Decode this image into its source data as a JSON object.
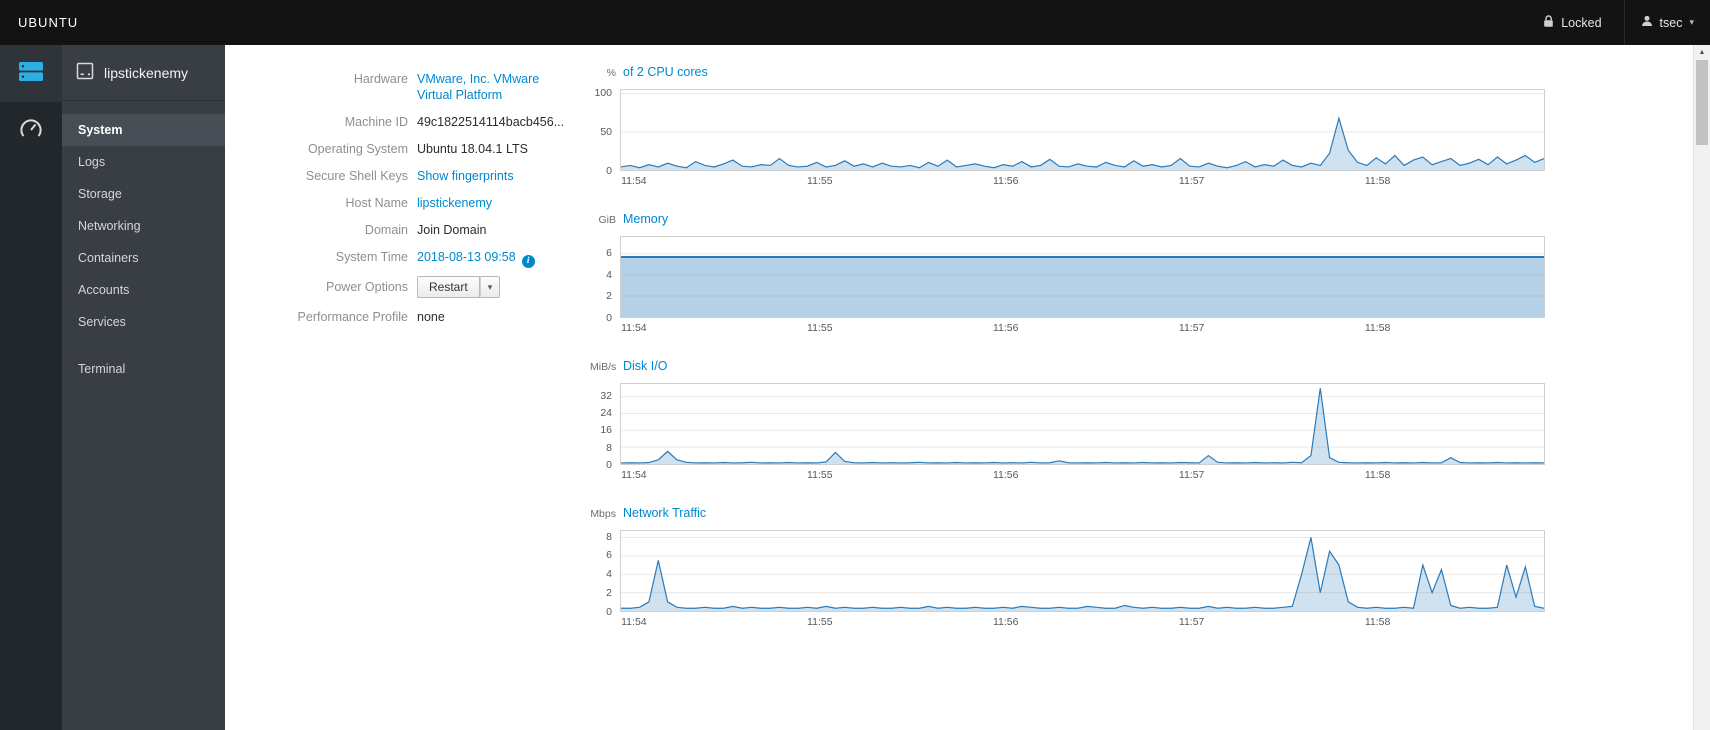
{
  "topbar": {
    "brand": "UBUNTU",
    "locked_label": "Locked",
    "user": "tsec"
  },
  "icons": {
    "caret_down": "▾",
    "scroll_up": "▲",
    "info": "i"
  },
  "sidebar": {
    "host": "lipstickenemy",
    "items": [
      {
        "label": "System",
        "active": true
      },
      {
        "label": "Logs",
        "active": false
      },
      {
        "label": "Storage",
        "active": false
      },
      {
        "label": "Networking",
        "active": false
      },
      {
        "label": "Containers",
        "active": false
      },
      {
        "label": "Accounts",
        "active": false
      },
      {
        "label": "Services",
        "active": false
      },
      {
        "label": "Terminal",
        "active": false
      }
    ]
  },
  "details": {
    "rows": [
      {
        "label": "Hardware",
        "value": "VMware, Inc. VMware Virtual Platform"
      },
      {
        "label": "Machine ID",
        "value": "49c1822514114bacb456..."
      },
      {
        "label": "Operating System",
        "value": "Ubuntu 18.04.1 LTS"
      },
      {
        "label": "Secure Shell Keys",
        "value": "Show fingerprints"
      },
      {
        "label": "Host Name",
        "value": "lipstickenemy"
      },
      {
        "label": "Domain",
        "value": "Join Domain"
      },
      {
        "label": "System Time",
        "value": "2018-08-13 09:58"
      },
      {
        "label": "Power Options",
        "value": "Restart"
      },
      {
        "label": "Performance Profile",
        "value": "none"
      }
    ]
  },
  "chart_data": [
    {
      "type": "area",
      "unit": "%",
      "title": "of 2 CPU cores",
      "ymax": 105,
      "y_ticks": [
        0,
        50,
        100
      ],
      "line_color": "#2b7bb9",
      "fill_color": "rgba(43,123,185,0.22)",
      "line_width": 1.2,
      "x_ticks": [
        {
          "pos": 0.015,
          "label": "11:54"
        },
        {
          "pos": 0.216,
          "label": "11:55"
        },
        {
          "pos": 0.417,
          "label": "11:56"
        },
        {
          "pos": 0.618,
          "label": "11:57"
        },
        {
          "pos": 0.819,
          "label": "11:58"
        }
      ],
      "values": [
        4,
        6,
        3,
        7,
        4,
        9,
        5,
        3,
        11,
        6,
        4,
        8,
        13,
        5,
        4,
        7,
        6,
        15,
        6,
        4,
        5,
        10,
        4,
        6,
        12,
        5,
        8,
        4,
        9,
        5,
        4,
        6,
        3,
        10,
        5,
        13,
        4,
        6,
        8,
        5,
        3,
        7,
        5,
        11,
        4,
        6,
        14,
        5,
        4,
        8,
        5,
        4,
        10,
        6,
        4,
        12,
        5,
        7,
        4,
        6,
        15,
        5,
        4,
        9,
        5,
        3,
        6,
        11,
        4,
        7,
        5,
        13,
        6,
        4,
        9,
        6,
        22,
        68,
        26,
        10,
        6,
        16,
        8,
        19,
        6,
        13,
        17,
        7,
        11,
        15,
        6,
        9,
        14,
        7,
        17,
        8,
        13,
        19,
        10,
        15
      ]
    },
    {
      "type": "area",
      "unit": "GiB",
      "title": "Memory",
      "ymax": 7.6,
      "y_ticks": [
        0,
        2,
        4,
        6
      ],
      "line_color": "#2b7bb9",
      "fill_color": "rgba(43,123,185,0.35)",
      "line_width": 2,
      "x_ticks": [
        {
          "pos": 0.015,
          "label": "11:54"
        },
        {
          "pos": 0.216,
          "label": "11:55"
        },
        {
          "pos": 0.417,
          "label": "11:56"
        },
        {
          "pos": 0.618,
          "label": "11:57"
        },
        {
          "pos": 0.819,
          "label": "11:58"
        }
      ],
      "values": [
        5.7,
        5.7,
        5.7,
        5.7,
        5.7,
        5.7,
        5.7,
        5.7,
        5.7,
        5.7,
        5.7,
        5.7,
        5.7,
        5.7,
        5.7,
        5.7,
        5.7,
        5.7,
        5.7,
        5.7,
        5.7,
        5.7,
        5.7,
        5.7,
        5.7
      ]
    },
    {
      "type": "area",
      "unit": "MiB/s",
      "title": "Disk I/O",
      "ymax": 38,
      "y_ticks": [
        0,
        8,
        16,
        24,
        32
      ],
      "line_color": "#2b7bb9",
      "fill_color": "rgba(43,123,185,0.22)",
      "line_width": 1.2,
      "x_ticks": [
        {
          "pos": 0.015,
          "label": "11:54"
        },
        {
          "pos": 0.216,
          "label": "11:55"
        },
        {
          "pos": 0.417,
          "label": "11:56"
        },
        {
          "pos": 0.618,
          "label": "11:57"
        },
        {
          "pos": 0.819,
          "label": "11:58"
        }
      ],
      "values": [
        0.5,
        0.6,
        0.5,
        0.7,
        2,
        6,
        2,
        0.8,
        0.5,
        0.6,
        0.5,
        0.7,
        0.5,
        0.6,
        0.8,
        0.5,
        0.6,
        0.5,
        0.7,
        0.5,
        0.6,
        0.5,
        1,
        5.5,
        1.2,
        0.6,
        0.5,
        0.7,
        0.5,
        0.6,
        0.5,
        0.6,
        0.8,
        0.5,
        0.6,
        0.5,
        0.7,
        0.5,
        0.6,
        0.5,
        0.7,
        0.5,
        0.6,
        0.5,
        0.8,
        0.5,
        0.6,
        1.5,
        0.6,
        0.5,
        0.6,
        0.5,
        0.7,
        0.5,
        0.6,
        0.5,
        0.7,
        0.5,
        0.6,
        0.5,
        0.7,
        0.6,
        0.5,
        4,
        0.8,
        0.5,
        0.6,
        0.5,
        0.7,
        0.5,
        0.6,
        0.5,
        0.8,
        0.6,
        4,
        36,
        3,
        0.8,
        0.6,
        0.5,
        0.6,
        0.5,
        0.7,
        0.5,
        0.6,
        0.5,
        0.7,
        0.5,
        0.6,
        3,
        0.7,
        0.5,
        0.6,
        0.5,
        0.7,
        0.5,
        0.6,
        0.5,
        0.6,
        0.5
      ]
    },
    {
      "type": "area",
      "unit": "Mbps",
      "title": "Network Traffic",
      "ymax": 8.7,
      "y_ticks": [
        0,
        2,
        4,
        6,
        8
      ],
      "line_color": "#2b7bb9",
      "fill_color": "rgba(43,123,185,0.22)",
      "line_width": 1.2,
      "x_ticks": [
        {
          "pos": 0.015,
          "label": "11:54"
        },
        {
          "pos": 0.216,
          "label": "11:55"
        },
        {
          "pos": 0.417,
          "label": "11:56"
        },
        {
          "pos": 0.618,
          "label": "11:57"
        },
        {
          "pos": 0.819,
          "label": "11:58"
        }
      ],
      "values": [
        0.3,
        0.3,
        0.4,
        1,
        5.5,
        1,
        0.4,
        0.3,
        0.3,
        0.4,
        0.3,
        0.3,
        0.5,
        0.3,
        0.4,
        0.3,
        0.3,
        0.4,
        0.3,
        0.3,
        0.4,
        0.3,
        0.5,
        0.3,
        0.4,
        0.3,
        0.3,
        0.4,
        0.3,
        0.3,
        0.4,
        0.3,
        0.3,
        0.5,
        0.3,
        0.4,
        0.3,
        0.3,
        0.4,
        0.3,
        0.3,
        0.4,
        0.3,
        0.5,
        0.4,
        0.3,
        0.3,
        0.4,
        0.3,
        0.3,
        0.5,
        0.4,
        0.3,
        0.3,
        0.6,
        0.4,
        0.3,
        0.4,
        0.3,
        0.3,
        0.4,
        0.3,
        0.3,
        0.5,
        0.3,
        0.4,
        0.3,
        0.3,
        0.4,
        0.3,
        0.3,
        0.4,
        0.5,
        4,
        8,
        2,
        6.5,
        5,
        1,
        0.4,
        0.3,
        0.4,
        0.3,
        0.3,
        0.4,
        0.3,
        5,
        2,
        4.5,
        0.6,
        0.3,
        0.4,
        0.3,
        0.3,
        0.4,
        5,
        1.5,
        4.8,
        0.5,
        0.3
      ]
    }
  ]
}
